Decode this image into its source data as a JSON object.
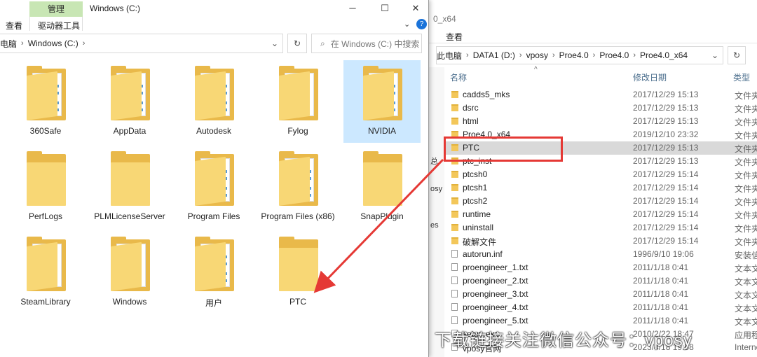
{
  "left_window": {
    "title": "Windows (C:)",
    "ribbon_manage_tab": "管理",
    "tabs": [
      "查看",
      "驱动器工具"
    ],
    "controls": {
      "minimize": "─",
      "maximize": "☐",
      "close": "✕"
    },
    "address": {
      "breadcrumbs": [
        "电脑",
        "Windows (C:)"
      ]
    },
    "search_placeholder": "在 Windows (C:) 中搜索",
    "items": [
      {
        "name": "360Safe",
        "type": "folder-docs",
        "selected": false
      },
      {
        "name": "AppData",
        "type": "folder-docs",
        "selected": false
      },
      {
        "name": "Autodesk",
        "type": "folder-docs",
        "selected": false
      },
      {
        "name": "Fylog",
        "type": "folder-white",
        "selected": false
      },
      {
        "name": "NVIDIA",
        "type": "folder-docs",
        "selected": true
      },
      {
        "name": "PerfLogs",
        "type": "folder-empty",
        "selected": false
      },
      {
        "name": "PLMLicenseServer",
        "type": "folder-empty",
        "selected": false
      },
      {
        "name": "Program Files",
        "type": "folder-docs",
        "selected": false
      },
      {
        "name": "Program Files (x86)",
        "type": "folder-docs",
        "selected": false
      },
      {
        "name": "SnapPlugin",
        "type": "folder-empty",
        "selected": false
      },
      {
        "name": "SteamLibrary",
        "type": "folder-gear",
        "selected": false
      },
      {
        "name": "Windows",
        "type": "folder-text",
        "selected": false
      },
      {
        "name": "用户",
        "type": "folder-docs",
        "selected": false
      },
      {
        "name": "PTC",
        "type": "folder-empty",
        "selected": false
      }
    ]
  },
  "right_window": {
    "title_fragment": "0_x64",
    "tab_view": "查看",
    "address": {
      "breadcrumbs": [
        "此电脑",
        "DATA1 (D:)",
        "vposy",
        "Proe4.0",
        "Proe4.0",
        "Proe4.0_x64"
      ]
    },
    "nav_fragments": [
      "总",
      "osy",
      "es"
    ],
    "columns": {
      "name": "名称",
      "date": "修改日期",
      "type": "类型"
    },
    "rows": [
      {
        "name": "cadds5_mks",
        "date": "2017/12/29 15:13",
        "type": "文件夹",
        "kind": "folder"
      },
      {
        "name": "dsrc",
        "date": "2017/12/29 15:13",
        "type": "文件夹",
        "kind": "folder"
      },
      {
        "name": "html",
        "date": "2017/12/29 15:13",
        "type": "文件夹",
        "kind": "folder"
      },
      {
        "name": "Proe4.0_x64",
        "date": "2019/12/10 23:32",
        "type": "文件夹",
        "kind": "folder"
      },
      {
        "name": "PTC",
        "date": "2017/12/29 15:13",
        "type": "文件夹",
        "kind": "folder",
        "selected": true
      },
      {
        "name": "ptc_inst",
        "date": "2017/12/29 15:13",
        "type": "文件夹",
        "kind": "folder"
      },
      {
        "name": "ptcsh0",
        "date": "2017/12/29 15:14",
        "type": "文件夹",
        "kind": "folder"
      },
      {
        "name": "ptcsh1",
        "date": "2017/12/29 15:14",
        "type": "文件夹",
        "kind": "folder"
      },
      {
        "name": "ptcsh2",
        "date": "2017/12/29 15:14",
        "type": "文件夹",
        "kind": "folder"
      },
      {
        "name": "runtime",
        "date": "2017/12/29 15:14",
        "type": "文件夹",
        "kind": "folder"
      },
      {
        "name": "uninstall",
        "date": "2017/12/29 15:14",
        "type": "文件夹",
        "kind": "folder"
      },
      {
        "name": "破解文件",
        "date": "2017/12/29 15:14",
        "type": "文件夹",
        "kind": "folder"
      },
      {
        "name": "autorun.inf",
        "date": "1996/9/10 19:06",
        "type": "安装信",
        "kind": "file"
      },
      {
        "name": "proengineer_1.txt",
        "date": "2011/1/18 0:41",
        "type": "文本文",
        "kind": "file"
      },
      {
        "name": "proengineer_2.txt",
        "date": "2011/1/18 0:41",
        "type": "文本文",
        "kind": "file"
      },
      {
        "name": "proengineer_3.txt",
        "date": "2011/1/18 0:41",
        "type": "文本文",
        "kind": "file"
      },
      {
        "name": "proengineer_4.txt",
        "date": "2011/1/18 0:41",
        "type": "文本文",
        "kind": "file"
      },
      {
        "name": "proengineer_5.txt",
        "date": "2011/1/18 0:41",
        "type": "文本文",
        "kind": "file"
      },
      {
        "name": "setup.exe",
        "date": "2010/2/22 18:47",
        "type": "应用程",
        "kind": "file"
      },
      {
        "name": "vposy官网",
        "date": "2023/4/18 19:58",
        "type": "Interne",
        "kind": "file"
      }
    ]
  },
  "watermark": "下载链接关注微信公众号：vposy",
  "colors": {
    "highlight": "#e53935",
    "selection": "#cce8ff",
    "folder": "#f8d775"
  }
}
